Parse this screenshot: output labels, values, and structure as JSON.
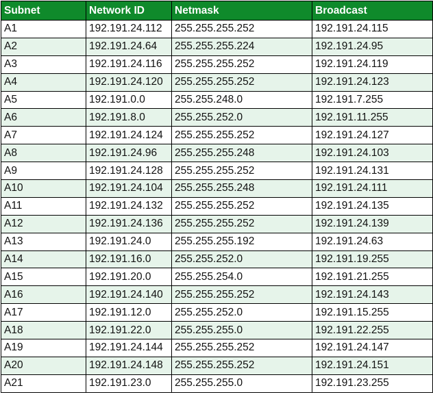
{
  "table": {
    "headers": [
      "Subnet",
      "Network ID",
      "Netmask",
      "Broadcast"
    ],
    "rows": [
      [
        "A1",
        "192.191.24.112",
        "255.255.255.252",
        "192.191.24.115"
      ],
      [
        "A2",
        "192.191.24.64",
        "255.255.255.224",
        "192.191.24.95"
      ],
      [
        "A3",
        "192.191.24.116",
        "255.255.255.252",
        "192.191.24.119"
      ],
      [
        "A4",
        "192.191.24.120",
        "255.255.255.252",
        "192.191.24.123"
      ],
      [
        "A5",
        "192.191.0.0",
        "255.255.248.0",
        "192.191.7.255"
      ],
      [
        "A6",
        "192.191.8.0",
        "255.255.252.0",
        "192.191.11.255"
      ],
      [
        "A7",
        "192.191.24.124",
        "255.255.255.252",
        "192.191.24.127"
      ],
      [
        "A8",
        "192.191.24.96",
        "255.255.255.248",
        "192.191.24.103"
      ],
      [
        "A9",
        "192.191.24.128",
        "255.255.255.252",
        "192.191.24.131"
      ],
      [
        "A10",
        "192.191.24.104",
        "255.255.255.248",
        "192.191.24.111"
      ],
      [
        "A11",
        "192.191.24.132",
        "255.255.255.252",
        "192.191.24.135"
      ],
      [
        "A12",
        "192.191.24.136",
        "255.255.255.252",
        "192.191.24.139"
      ],
      [
        "A13",
        "192.191.24.0",
        "255.255.255.192",
        "192.191.24.63"
      ],
      [
        "A14",
        "192.191.16.0",
        "255.255.252.0",
        "192.191.19.255"
      ],
      [
        "A15",
        "192.191.20.0",
        "255.255.254.0",
        "192.191.21.255"
      ],
      [
        "A16",
        "192.191.24.140",
        "255.255.255.252",
        "192.191.24.143"
      ],
      [
        "A17",
        "192.191.12.0",
        "255.255.252.0",
        "192.191.15.255"
      ],
      [
        "A18",
        "192.191.22.0",
        "255.255.255.0",
        "192.191.22.255"
      ],
      [
        "A19",
        "192.191.24.144",
        "255.255.255.252",
        "192.191.24.147"
      ],
      [
        "A20",
        "192.191.24.148",
        "255.255.255.252",
        "192.191.24.151"
      ],
      [
        "A21",
        "192.191.23.0",
        "255.255.255.0",
        "192.191.23.255"
      ]
    ]
  },
  "colors": {
    "header_background": "#0f8a2b",
    "header_text": "#ffffff",
    "stripe_background": "#e6f4ea"
  }
}
